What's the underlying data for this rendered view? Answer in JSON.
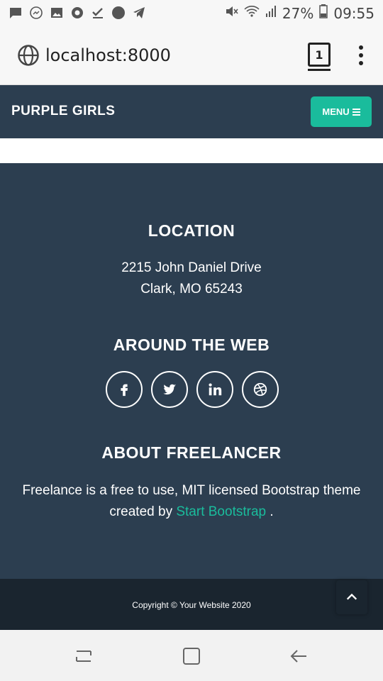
{
  "status_bar": {
    "battery_percent": "27%",
    "time": "09:55",
    "icons": [
      "message-icon",
      "messenger-icon",
      "image-icon",
      "chrome-icon",
      "check-icon",
      "circle-icon",
      "telegram-icon",
      "mute-icon",
      "wifi-icon",
      "signal-icon",
      "battery-icon"
    ]
  },
  "browser": {
    "url": "localhost:8000",
    "tab_count": "1"
  },
  "navbar": {
    "brand": "PURPLE GIRLS",
    "menu_label": "MENU"
  },
  "footer": {
    "location": {
      "title": "LOCATION",
      "line1": "2215 John Daniel Drive",
      "line2": "Clark, MO 65243"
    },
    "web": {
      "title": "AROUND THE WEB",
      "socials": [
        "facebook-icon",
        "twitter-icon",
        "linkedin-icon",
        "dribbble-icon"
      ]
    },
    "about": {
      "title": "ABOUT FREELANCER",
      "line1": "Freelance is a free to use, MIT licensed Bootstrap theme",
      "line2_prefix": "created by",
      "link_text": "Start Bootstrap",
      "line2_suffix": "."
    }
  },
  "copyright": {
    "text": "Copyright © Your Website 2020"
  },
  "colors": {
    "primary": "#2c3e50",
    "accent": "#1abc9c",
    "dark": "#1a252f"
  }
}
